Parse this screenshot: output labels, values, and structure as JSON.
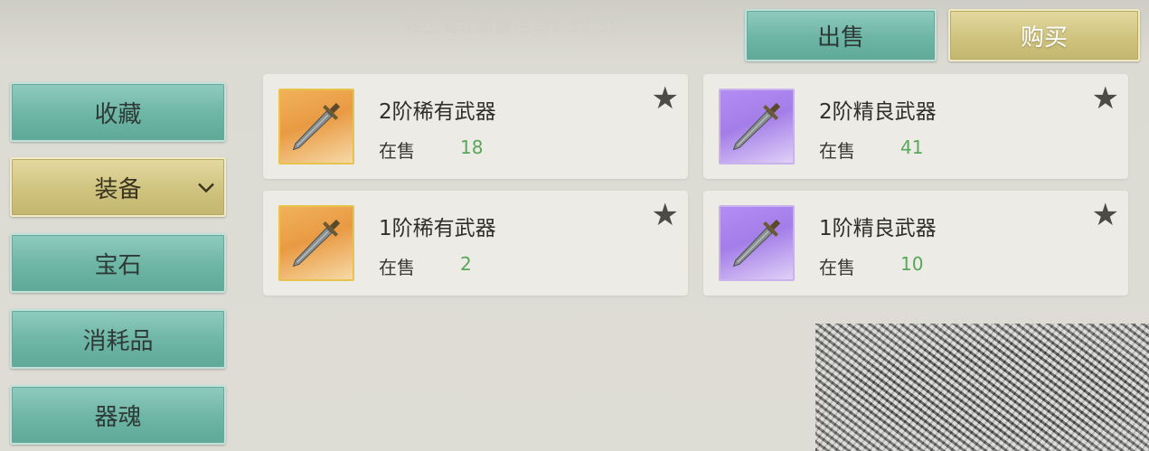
{
  "banner_text": "核上有礼新服活动1 38.58",
  "top_buttons": {
    "sell": "出售",
    "buy": "购买"
  },
  "sidebar": {
    "items": [
      {
        "label": "收藏",
        "state": "normal"
      },
      {
        "label": "装备",
        "state": "selected",
        "chevron": "chevron-down-icon"
      },
      {
        "label": "宝石",
        "state": "normal"
      },
      {
        "label": "消耗品",
        "state": "normal"
      },
      {
        "label": "器魂",
        "state": "normal"
      }
    ]
  },
  "listings": [
    {
      "name": "2阶稀有武器",
      "onsale_label": "在售",
      "count": "18",
      "rarity": "orange",
      "icon": "sword-icon"
    },
    {
      "name": "2阶精良武器",
      "onsale_label": "在售",
      "count": "41",
      "rarity": "purple",
      "icon": "sword-icon"
    },
    {
      "name": "1阶稀有武器",
      "onsale_label": "在售",
      "count": "2",
      "rarity": "orange",
      "icon": "sword-icon"
    },
    {
      "name": "1阶精良武器",
      "onsale_label": "在售",
      "count": "10",
      "rarity": "purple",
      "icon": "sword-icon"
    }
  ],
  "colors": {
    "green_button": "#6db5a5",
    "gold_button": "#cfc37f",
    "count_text": "#58a85a",
    "rare_orange": "#e99a43",
    "fine_purple": "#a47ee8"
  }
}
